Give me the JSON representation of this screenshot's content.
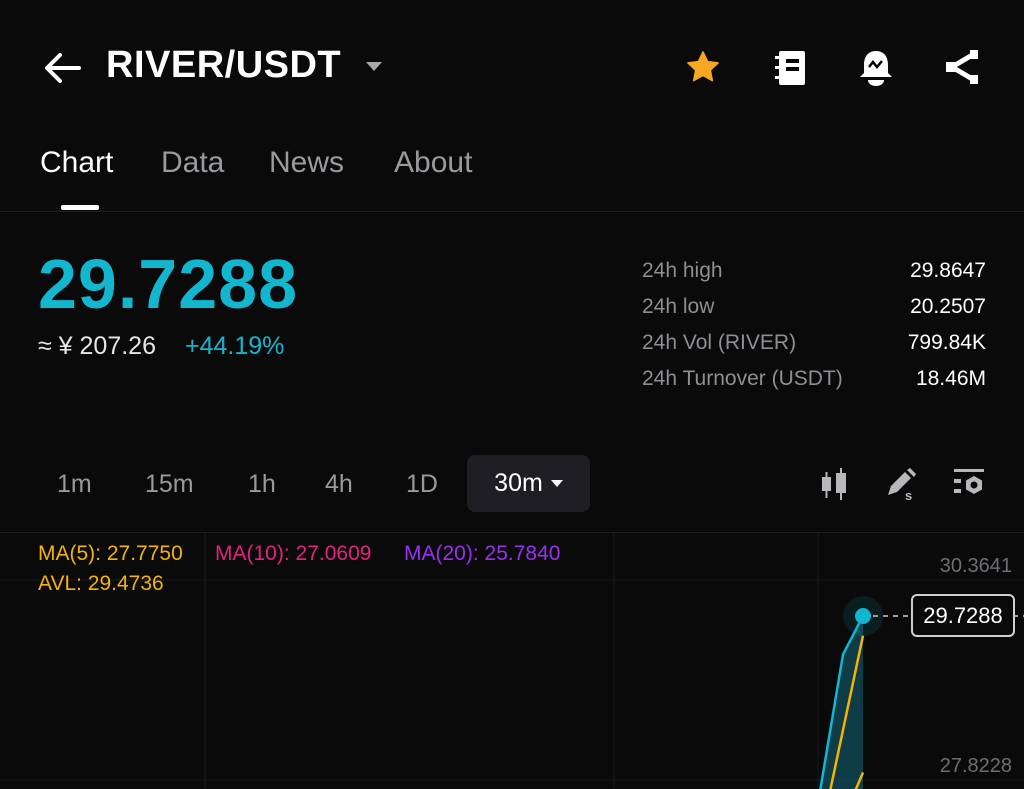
{
  "header": {
    "title": "RIVER/USDT",
    "icons": [
      "back-arrow-icon",
      "chevron-down-icon",
      "star-icon",
      "notebook-icon",
      "price-alert-bell-icon",
      "share-icon"
    ],
    "star_color": "#f5a623"
  },
  "tabs": [
    {
      "label": "Chart"
    },
    {
      "label": "Data"
    },
    {
      "label": "News"
    },
    {
      "label": "About"
    }
  ],
  "ticker": {
    "price": "29.7288",
    "cny": "≈ ¥ 207.26",
    "change": "+44.19%",
    "accent": "#12b6cf"
  },
  "stats": [
    {
      "label": "24h high",
      "value": "29.8647"
    },
    {
      "label": "24h low",
      "value": "20.2507"
    },
    {
      "label": "24h Vol (RIVER)",
      "value": "799.84K"
    },
    {
      "label": "24h Turnover (USDT)",
      "value": "18.46M"
    }
  ],
  "timeframes": [
    "1m",
    "15m",
    "1h",
    "4h",
    "1D"
  ],
  "selected_timeframe": "30m",
  "indicators": {
    "ma5": "MA(5): 27.7750",
    "ma10": "MA(10): 27.0609",
    "ma20": "MA(20): 25.7840",
    "avl": "AVL: 29.4736"
  },
  "chart_data": {
    "type": "line",
    "y_ticks": [
      "30.3641",
      "27.8228"
    ],
    "ylim": [
      27.5,
      30.6
    ],
    "last_price_label": "29.7288",
    "series": [
      {
        "name": "price",
        "color": "#12b6cf",
        "values": [
          27.5,
          29.24,
          29.7288
        ]
      },
      {
        "name": "MA(5)",
        "color": "#f5b400",
        "values": [
          27.5,
          29.48
        ]
      },
      {
        "name": "MA(10)",
        "color": "#f5b400",
        "values": [
          27.5,
          27.74
        ]
      }
    ]
  }
}
